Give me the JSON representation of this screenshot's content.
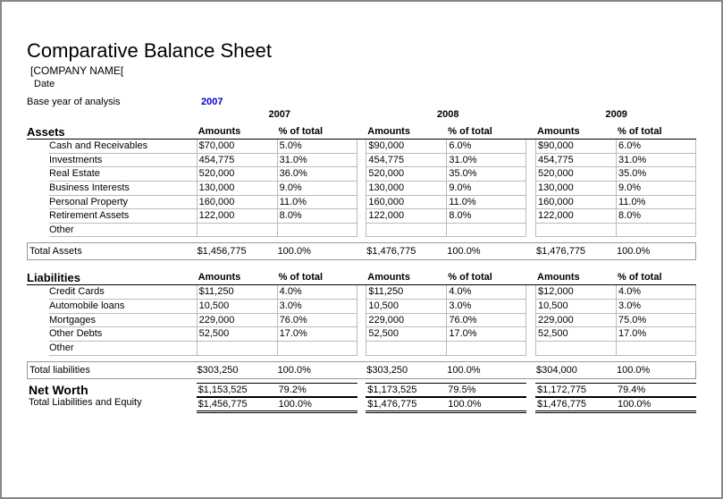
{
  "title": "Comparative Balance Sheet",
  "company": "[COMPANY NAME[",
  "date": "Date",
  "base_label": "Base year of analysis",
  "base_year": "2007",
  "years": [
    "2007",
    "2008",
    "2009"
  ],
  "col_labels": {
    "amounts": "Amounts",
    "pct": "% of total"
  },
  "assets": {
    "heading": "Assets",
    "rows": [
      {
        "label": "Cash and Receivables",
        "y": [
          [
            "$70,000",
            "5.0%"
          ],
          [
            "$90,000",
            "6.0%"
          ],
          [
            "$90,000",
            "6.0%"
          ]
        ]
      },
      {
        "label": "Investments",
        "y": [
          [
            "454,775",
            "31.0%"
          ],
          [
            "454,775",
            "31.0%"
          ],
          [
            "454,775",
            "31.0%"
          ]
        ]
      },
      {
        "label": "Real Estate",
        "y": [
          [
            "520,000",
            "36.0%"
          ],
          [
            "520,000",
            "35.0%"
          ],
          [
            "520,000",
            "35.0%"
          ]
        ]
      },
      {
        "label": "Business Interests",
        "y": [
          [
            "130,000",
            "9.0%"
          ],
          [
            "130,000",
            "9.0%"
          ],
          [
            "130,000",
            "9.0%"
          ]
        ]
      },
      {
        "label": "Personal Property",
        "y": [
          [
            "160,000",
            "11.0%"
          ],
          [
            "160,000",
            "11.0%"
          ],
          [
            "160,000",
            "11.0%"
          ]
        ]
      },
      {
        "label": "Retirement Assets",
        "y": [
          [
            "122,000",
            "8.0%"
          ],
          [
            "122,000",
            "8.0%"
          ],
          [
            "122,000",
            "8.0%"
          ]
        ]
      },
      {
        "label": "Other",
        "y": [
          [
            "",
            ""
          ],
          [
            "",
            ""
          ],
          [
            "",
            ""
          ]
        ]
      }
    ],
    "total_label": "Total Assets",
    "total": [
      [
        "$1,456,775",
        "100.0%"
      ],
      [
        "$1,476,775",
        "100.0%"
      ],
      [
        "$1,476,775",
        "100.0%"
      ]
    ]
  },
  "liabilities": {
    "heading": "Liabilities",
    "rows": [
      {
        "label": "Credit Cards",
        "y": [
          [
            "$11,250",
            "4.0%"
          ],
          [
            "$11,250",
            "4.0%"
          ],
          [
            "$12,000",
            "4.0%"
          ]
        ]
      },
      {
        "label": "Automobile loans",
        "y": [
          [
            "10,500",
            "3.0%"
          ],
          [
            "10,500",
            "3.0%"
          ],
          [
            "10,500",
            "3.0%"
          ]
        ]
      },
      {
        "label": "Mortgages",
        "y": [
          [
            "229,000",
            "76.0%"
          ],
          [
            "229,000",
            "76.0%"
          ],
          [
            "229,000",
            "75.0%"
          ]
        ]
      },
      {
        "label": "Other Debts",
        "y": [
          [
            "52,500",
            "17.0%"
          ],
          [
            "52,500",
            "17.0%"
          ],
          [
            "52,500",
            "17.0%"
          ]
        ]
      },
      {
        "label": "Other",
        "y": [
          [
            "",
            ""
          ],
          [
            "",
            ""
          ],
          [
            "",
            ""
          ]
        ]
      }
    ],
    "total_label": "Total liabilities",
    "total": [
      [
        "$303,250",
        "100.0%"
      ],
      [
        "$303,250",
        "100.0%"
      ],
      [
        "$304,000",
        "100.0%"
      ]
    ]
  },
  "networth": {
    "label": "Net Worth",
    "y": [
      [
        "$1,153,525",
        "79.2%"
      ],
      [
        "$1,173,525",
        "79.5%"
      ],
      [
        "$1,172,775",
        "79.4%"
      ]
    ]
  },
  "tle": {
    "label": "Total Liabilities and Equity",
    "y": [
      [
        "$1,456,775",
        "100.0%"
      ],
      [
        "$1,476,775",
        "100.0%"
      ],
      [
        "$1,476,775",
        "100.0%"
      ]
    ]
  }
}
